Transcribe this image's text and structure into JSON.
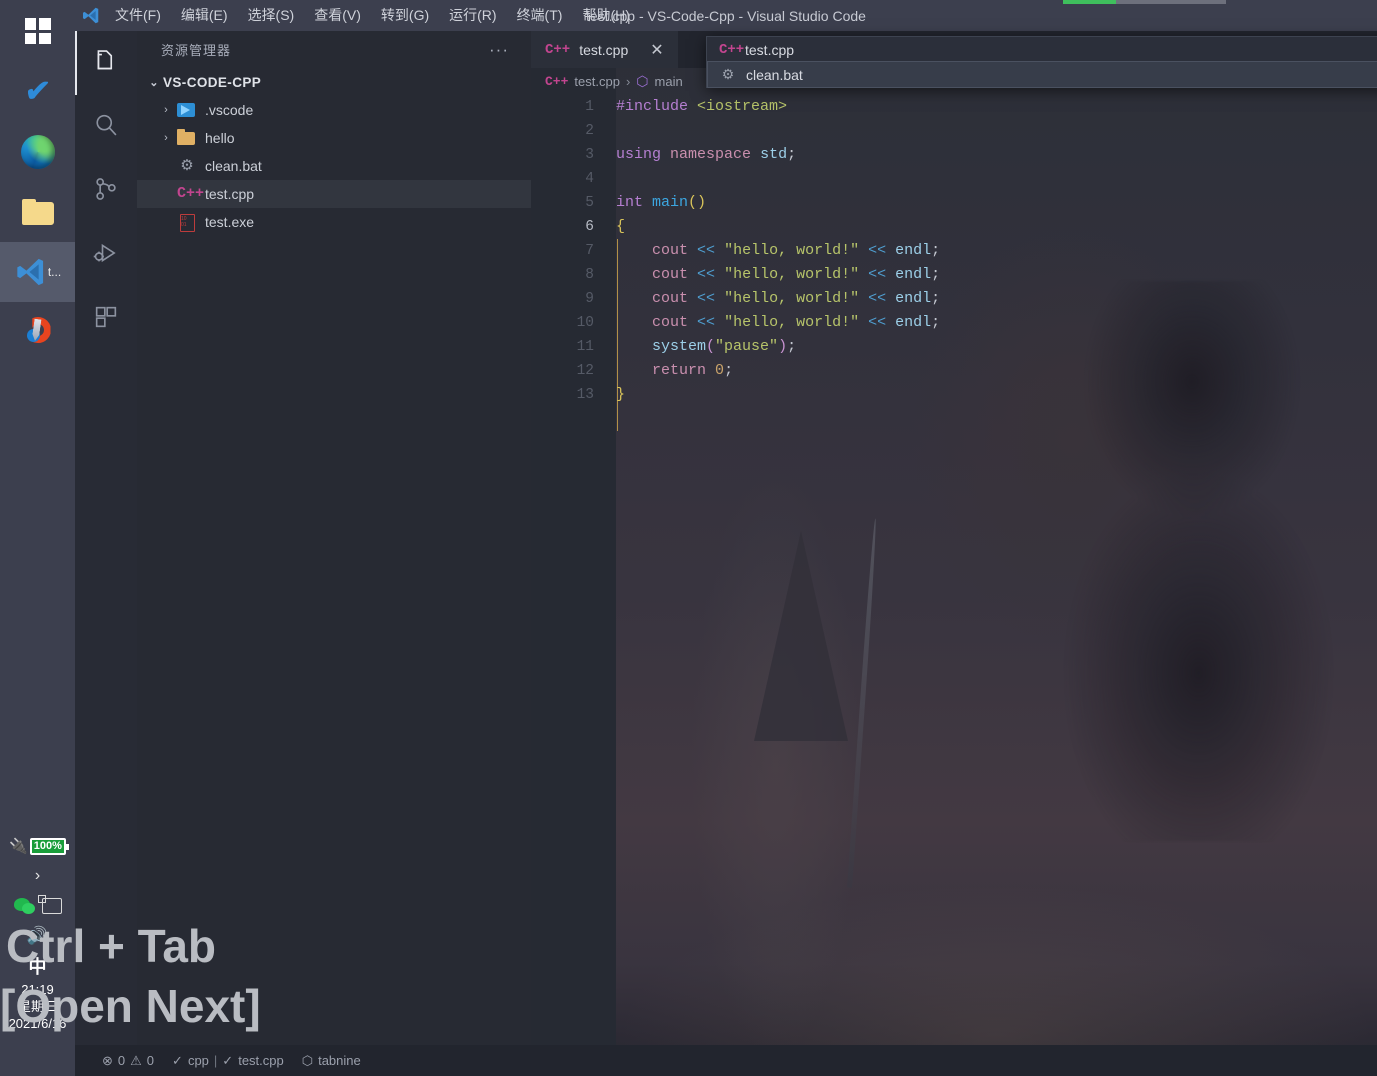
{
  "window": {
    "title": "test.cpp - VS-Code-Cpp - Visual Studio Code",
    "progress_percent": 33
  },
  "menubar": {
    "items": [
      {
        "label": "文件(F)",
        "name": "menu-file"
      },
      {
        "label": "编辑(E)",
        "name": "menu-edit"
      },
      {
        "label": "选择(S)",
        "name": "menu-selection"
      },
      {
        "label": "查看(V)",
        "name": "menu-view"
      },
      {
        "label": "转到(G)",
        "name": "menu-go"
      },
      {
        "label": "运行(R)",
        "name": "menu-run"
      },
      {
        "label": "终端(T)",
        "name": "menu-terminal"
      },
      {
        "label": "帮助(H)",
        "name": "menu-help"
      }
    ]
  },
  "activitybar": {
    "items": [
      {
        "icon": "files-explorer-icon",
        "active": true
      },
      {
        "icon": "search-icon",
        "active": false
      },
      {
        "icon": "source-control-icon",
        "active": false
      },
      {
        "icon": "run-and-debug-icon",
        "active": false
      },
      {
        "icon": "extensions-icon",
        "active": false
      }
    ]
  },
  "sidebar": {
    "header_title": "资源管理器",
    "more_actions": "···",
    "root_label": "VS-CODE-CPP",
    "root_caret": "⌄",
    "tree": [
      {
        "label": ".vscode",
        "icon": "vscode-folder-icon",
        "arrow": "›",
        "selected": false
      },
      {
        "label": "hello",
        "icon": "folder-icon",
        "arrow": "›",
        "selected": false
      },
      {
        "label": "clean.bat",
        "icon": "gear-icon",
        "arrow": "",
        "selected": false
      },
      {
        "label": "test.cpp",
        "icon": "cpp-file-icon",
        "arrow": "",
        "selected": true
      },
      {
        "label": "test.exe",
        "icon": "exe-file-icon",
        "arrow": "",
        "selected": false
      }
    ]
  },
  "editor": {
    "tabs": [
      {
        "label": "test.cpp",
        "icon_text": "C++",
        "close": "✕",
        "active": true
      }
    ],
    "breadcrumb": {
      "file_icon_text": "C++",
      "file": "test.cpp",
      "separator": "›",
      "symbol_icon": "⬡",
      "symbol": "main"
    },
    "lines": [
      {
        "no": "1",
        "current": false
      },
      {
        "no": "2",
        "current": false
      },
      {
        "no": "3",
        "current": false
      },
      {
        "no": "4",
        "current": false
      },
      {
        "no": "5",
        "current": false
      },
      {
        "no": "6",
        "current": true
      },
      {
        "no": "7",
        "current": false
      },
      {
        "no": "8",
        "current": false
      },
      {
        "no": "9",
        "current": false
      },
      {
        "no": "10",
        "current": false
      },
      {
        "no": "11",
        "current": false
      },
      {
        "no": "12",
        "current": false
      },
      {
        "no": "13",
        "current": false
      }
    ],
    "code": {
      "l1_hash_include": "#include",
      "l1_header": "<iostream>",
      "l3_using": "using",
      "l3_namespace": "namespace",
      "l3_std": "std",
      "l3_semi": ";",
      "l5_int": "int",
      "l5_main": "main",
      "l5_parens": "()",
      "l6_open_brace": "{",
      "cout": "cout",
      "shift_op": "<<",
      "hello_str": "\"hello, world!\"",
      "endl": "endl",
      "semi": ";",
      "l11_system": "system",
      "l11_open_paren": "(",
      "l11_pause": "\"pause\"",
      "l11_close_paren": ")",
      "l11_semi": ";",
      "l12_return": "return",
      "l12_zero": "0",
      "l12_semi": ";",
      "l13_close_brace": "}"
    }
  },
  "quickpick": {
    "items": [
      {
        "label": "test.cpp",
        "icon": "cpp-file-icon",
        "icon_text": "C++",
        "selected": false,
        "close": ""
      },
      {
        "label": "clean.bat",
        "icon": "gear-icon",
        "icon_text": "⚙",
        "selected": true,
        "close": "✕"
      }
    ]
  },
  "statusbar": {
    "errors_icon": "⊗",
    "errors": "0",
    "warnings_icon": "⚠",
    "warnings": "0",
    "check_icon": "✓",
    "language": "cpp",
    "separator": "|",
    "file_check_icon": "✓",
    "file": "test.cpp",
    "tabnine_icon": "⬡",
    "tabnine": "tabnine"
  },
  "taskbar": {
    "items": [
      {
        "name": "windows-start-button",
        "icon": "windows-logo-icon",
        "label": ""
      },
      {
        "name": "taskbar-todo",
        "icon": "blue-check-icon",
        "label": ""
      },
      {
        "name": "taskbar-edge",
        "icon": "edge-browser-icon",
        "label": ""
      },
      {
        "name": "taskbar-file-explorer",
        "icon": "folder-icon",
        "label": ""
      },
      {
        "name": "taskbar-vscode",
        "icon": "vscode-icon",
        "label": "t..."
      },
      {
        "name": "taskbar-pdf-reader",
        "icon": "pdf-reader-icon",
        "label": ""
      }
    ],
    "tray": {
      "battery_percent": "100%",
      "plug_icon": "power-plug-icon",
      "chevron_icon": "›",
      "wechat_icon": "wechat-icon",
      "monitor_icon": "monitor-icon",
      "speaker_icon": "speaker-icon",
      "ime_label": "中"
    },
    "clock": {
      "time": "21:19",
      "weekday": "星期三",
      "date": "2021/6/16"
    }
  },
  "overlay_caption": {
    "line1": "Ctrl + Tab",
    "line2": "[Open Next]"
  },
  "colors": {
    "accent": "#3fbf5d",
    "cpp_icon": "#c2458f",
    "selected_row": "#32363f",
    "taskbar_bg": "#3c3f4e"
  }
}
